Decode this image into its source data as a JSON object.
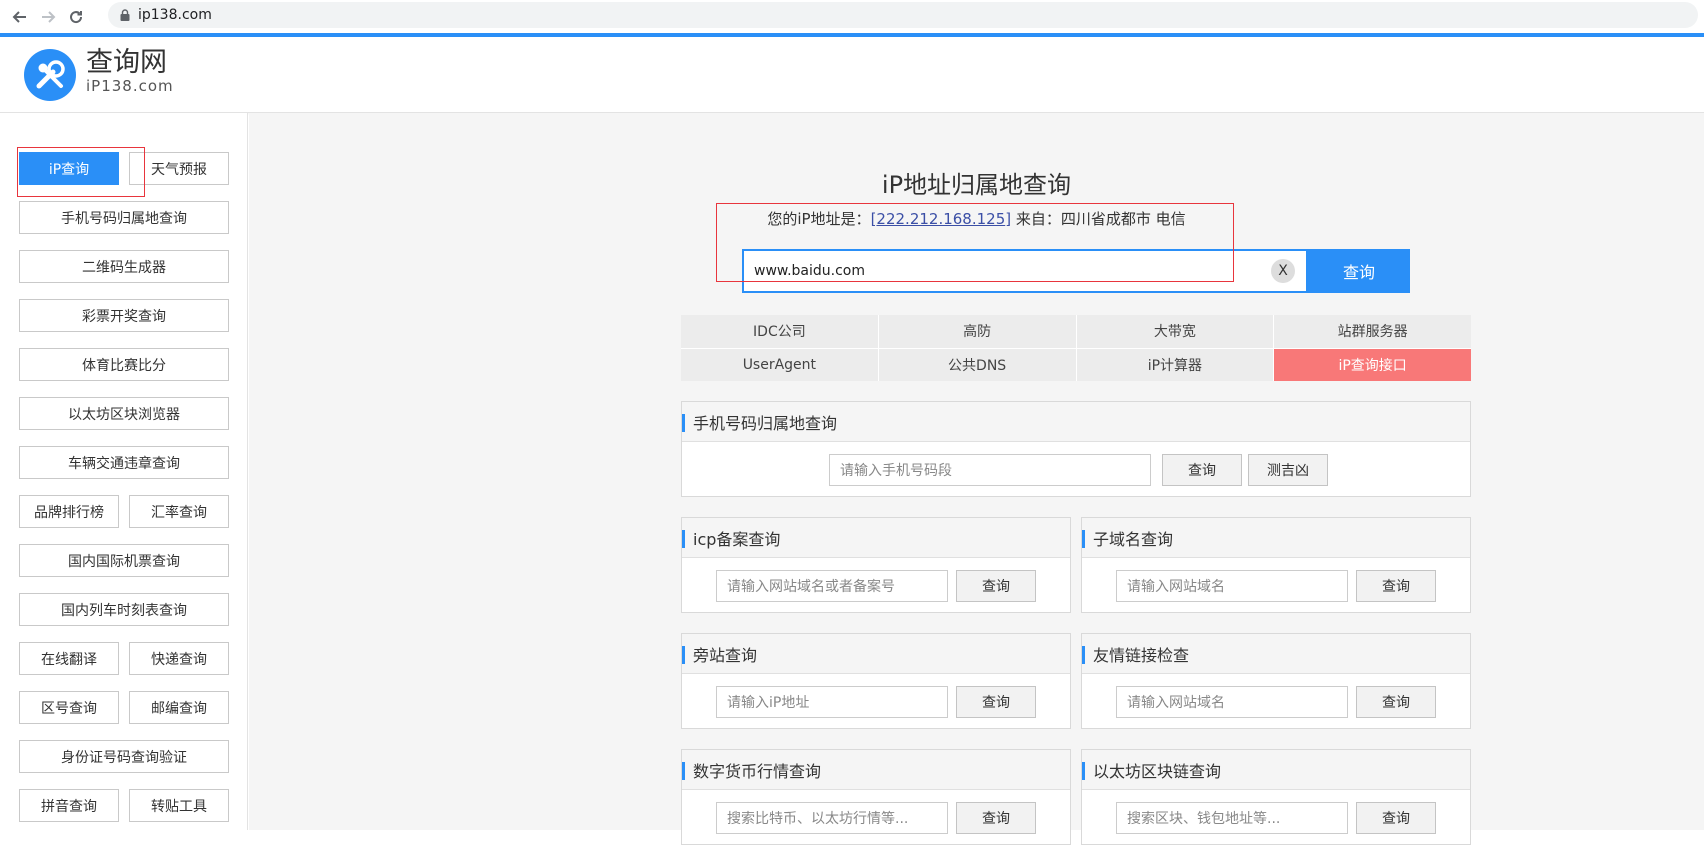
{
  "browser": {
    "url": "ip138.com"
  },
  "header": {
    "brand_name": "查询网",
    "brand_sub": "iP138.com"
  },
  "sidebar": {
    "items": [
      {
        "label": "iP查询"
      },
      {
        "label": "天气预报"
      },
      {
        "label": "手机号码归属地查询"
      },
      {
        "label": "二维码生成器"
      },
      {
        "label": "彩票开奖查询"
      },
      {
        "label": "体育比赛比分"
      },
      {
        "label": "以太坊区块浏览器"
      },
      {
        "label": "车辆交通违章查询"
      },
      {
        "label": "品牌排行榜"
      },
      {
        "label": "汇率查询"
      },
      {
        "label": "国内国际机票查询"
      },
      {
        "label": "国内列车时刻表查询"
      },
      {
        "label": "在线翻译"
      },
      {
        "label": "快递查询"
      },
      {
        "label": "区号查询"
      },
      {
        "label": "邮编查询"
      },
      {
        "label": "身份证号码查询验证"
      },
      {
        "label": "拼音查询"
      },
      {
        "label": "转贴工具"
      }
    ]
  },
  "main": {
    "title": "iP地址归属地查询",
    "yourip_prefix": "您的iP地址是：",
    "yourip_bracket_open": "[",
    "yourip_value": "222.212.168.125",
    "yourip_bracket_close": "]",
    "yourip_suffix": " 来自：四川省成都市 电信",
    "search_value": "www.baidu.com",
    "clear_label": "X",
    "search_button": "查询",
    "links": [
      "IDC公司",
      "高防",
      "大带宽",
      "站群服务器",
      "UserAgent",
      "公共DNS",
      "iP计算器",
      "iP查询接口"
    ]
  },
  "panels": {
    "phone": {
      "title": "手机号码归属地查询",
      "placeholder": "请输入手机号码段",
      "btn": "查询",
      "btn2": "测吉凶"
    },
    "icp": {
      "title": "icp备案查询",
      "placeholder": "请输入网站域名或者备案号",
      "btn": "查询"
    },
    "subdomain": {
      "title": "子域名查询",
      "placeholder": "请输入网站域名",
      "btn": "查询"
    },
    "sidesite": {
      "title": "旁站查询",
      "placeholder": "请输入iP地址",
      "btn": "查询"
    },
    "friendlink": {
      "title": "友情链接检查",
      "placeholder": "请输入网站域名",
      "btn": "查询"
    },
    "crypto": {
      "title": "数字货币行情查询",
      "placeholder": "搜索比特币、以太坊行情等...",
      "btn": "查询"
    },
    "eth": {
      "title": "以太坊区块链查询",
      "placeholder": "搜索区块、钱包地址等...",
      "btn": "查询"
    }
  }
}
